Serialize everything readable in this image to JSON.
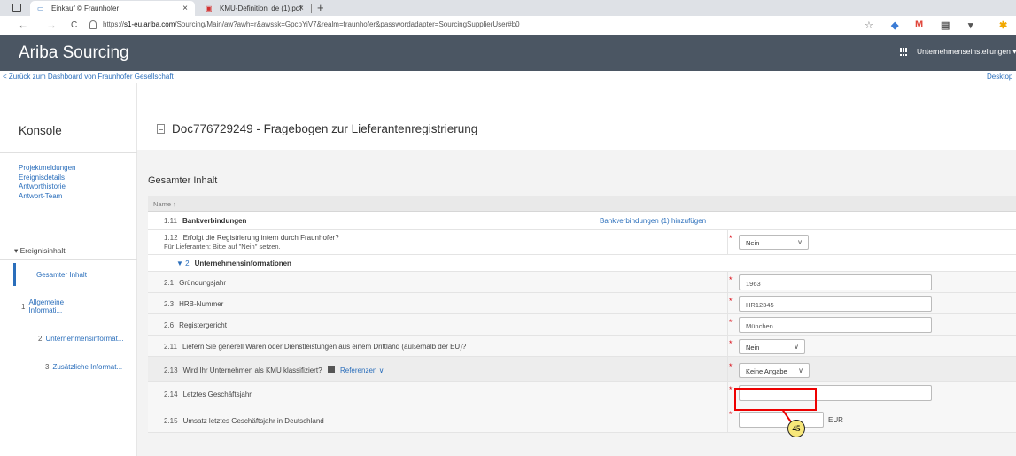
{
  "browser": {
    "tabs": [
      {
        "title": "Einkauf © Fraunhofer",
        "active": true
      },
      {
        "title": "KMU-Definition_de (1).pdf",
        "active": false
      }
    ],
    "url_prefix": "https://",
    "url_host": "s1-eu.ariba.com",
    "url_rest": "/Sourcing/Main/aw?awh=r&awssk=GpcpYiV7&realm=fraunhofer&passwordadapter=SourcingSupplierUser#b0",
    "close_glyph": "×",
    "newtab_glyph": "+",
    "back_glyph": "←",
    "forward_glyph": "→",
    "reload_glyph": "C"
  },
  "header": {
    "app_title": "Ariba Sourcing",
    "company_settings": "Unternehmenseinstellungen ▾"
  },
  "backbar": {
    "back_link": "< Zurück zum Dashboard von Fraunhofer Gesellschaft",
    "desktop_link": "Desktop"
  },
  "sidebar": {
    "title": "Konsole",
    "links": [
      "Projektmeldungen",
      "Ereignisdetails",
      "Antworthistorie",
      "Antwort-Team"
    ],
    "events_header": "▾ Ereignisinhalt",
    "items": [
      {
        "num": "",
        "label": "Gesamter Inhalt"
      },
      {
        "num": "1",
        "label": "Allgemeine Informati..."
      },
      {
        "num": "2",
        "label": "Unternehmensinformat..."
      },
      {
        "num": "3",
        "label": "Zusätzliche Informat..."
      }
    ]
  },
  "main": {
    "doc_title": "Doc776729249 - Fragebogen zur Lieferantenregistrierung",
    "content_title": "Gesamter Inhalt",
    "column_name": "Name ↑",
    "rows": [
      {
        "num": "1.11",
        "label": "Bankverbindungen",
        "action": "Bankverbindungen (1) hinzufügen"
      },
      {
        "num": "1.12",
        "label": "Erfolgt die Registrierung intern durch Fraunhofer?",
        "sub": "Für Lieferanten: Bitte auf \"Nein\" setzen.",
        "value": "Nein"
      },
      {
        "num": "▼ 2",
        "label": "Unternehmensinformationen"
      },
      {
        "num": "2.1",
        "label": "Gründungsjahr",
        "value": "1963"
      },
      {
        "num": "2.3",
        "label": "HRB-Nummer",
        "value": "HR12345"
      },
      {
        "num": "2.6",
        "label": "Registergericht",
        "value": "München"
      },
      {
        "num": "2.11",
        "label": "Liefern Sie generell Waren oder Dienstleistungen aus einem Drittland (außerhalb der EU)?",
        "value": "Nein"
      },
      {
        "num": "2.13",
        "label": "Wird Ihr Unternehmen als KMU klassifiziert?",
        "ref": "Referenzen",
        "value": "Keine Angabe"
      },
      {
        "num": "2.14",
        "label": "Letztes Geschäftsjahr",
        "value": ""
      },
      {
        "num": "2.15",
        "label": "Umsatz letztes Geschäftsjahr in Deutschland",
        "value": "",
        "unit": "EUR"
      }
    ]
  },
  "annotation": {
    "callout_number": "45",
    "color": "#e00000"
  }
}
